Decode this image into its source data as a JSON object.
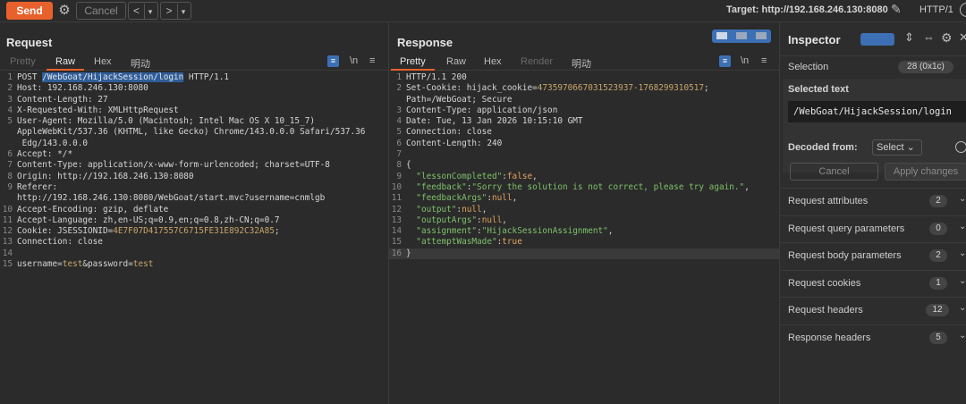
{
  "toolbar": {
    "send_label": "Send",
    "cancel_label": "Cancel",
    "prev_glyph": "<",
    "next_glyph": ">",
    "dropdown_glyph": "▾",
    "target_label": "Target: http://192.168.246.130:8080",
    "http_version": "HTTP/1"
  },
  "request": {
    "title": "Request",
    "tabs": [
      {
        "label": "Pretty"
      },
      {
        "label": "Raw"
      },
      {
        "label": "Hex"
      },
      {
        "label": "明动"
      }
    ],
    "newline_toggle": "\\n",
    "lines": [
      {
        "n": "1",
        "parts": [
          [
            "k",
            "POST "
          ],
          [
            "sel",
            "/WebGoat/HijackSession/login"
          ],
          [
            "k",
            " HTTP/1.1"
          ]
        ]
      },
      {
        "n": "2",
        "parts": [
          [
            "k",
            "Host: "
          ],
          [
            "k",
            "192.168.246.130:8080"
          ]
        ]
      },
      {
        "n": "3",
        "parts": [
          [
            "k",
            "Content-Length: 27"
          ]
        ]
      },
      {
        "n": "4",
        "parts": [
          [
            "k",
            "X-Requested-With: "
          ],
          [
            "k",
            "XMLHttpRequest"
          ]
        ]
      },
      {
        "n": "5",
        "parts": [
          [
            "k",
            "User-Agent: "
          ],
          [
            "k",
            "Mozilla/5.0 (Macintosh; Intel Mac OS X 10_15_7)"
          ]
        ]
      },
      {
        "n": "",
        "parts": [
          [
            "k",
            "AppleWebKit/537.36 (KHTML, like Gecko) Chrome/143.0.0.0 Safari/537.36"
          ]
        ]
      },
      {
        "n": "",
        "parts": [
          [
            "k",
            " Edg/143.0.0.0"
          ]
        ]
      },
      {
        "n": "6",
        "parts": [
          [
            "k",
            "Accept: "
          ],
          [
            "k",
            "*/*"
          ]
        ]
      },
      {
        "n": "7",
        "parts": [
          [
            "k",
            "Content-Type: "
          ],
          [
            "k",
            "application/x-www-form-urlencoded; charset=UTF-8"
          ]
        ]
      },
      {
        "n": "8",
        "parts": [
          [
            "k",
            "Origin: "
          ],
          [
            "k",
            "http://192.168.246.130:8080"
          ]
        ]
      },
      {
        "n": "9",
        "parts": [
          [
            "k",
            "Referer:"
          ]
        ]
      },
      {
        "n": "",
        "parts": [
          [
            "k",
            "http://192.168.246.130:8080/WebGoat/start.mvc?username=cnmlgb"
          ]
        ]
      },
      {
        "n": "10",
        "parts": [
          [
            "k",
            "Accept-Encoding: "
          ],
          [
            "k",
            "gzip, deflate"
          ]
        ]
      },
      {
        "n": "11",
        "parts": [
          [
            "k",
            "Accept-Language: "
          ],
          [
            "k",
            "zh,en-US;q=0.9,en;q=0.8,zh-CN;q=0.7"
          ]
        ]
      },
      {
        "n": "12",
        "parts": [
          [
            "k",
            "Cookie: JSESSIONID="
          ],
          [
            "v",
            "4E7F07D417557C6715FE31E892C32A85"
          ],
          [
            "k",
            ";"
          ]
        ]
      },
      {
        "n": "13",
        "parts": [
          [
            "k",
            "Connection: "
          ],
          [
            "k",
            "close"
          ]
        ]
      },
      {
        "n": "14",
        "parts": []
      },
      {
        "n": "15",
        "parts": [
          [
            "k",
            "username="
          ],
          [
            "v",
            "test"
          ],
          [
            "k",
            "&password="
          ],
          [
            "v",
            "test"
          ]
        ]
      }
    ]
  },
  "response": {
    "title": "Response",
    "tabs": [
      {
        "label": "Pretty"
      },
      {
        "label": "Raw"
      },
      {
        "label": "Hex"
      },
      {
        "label": "Render"
      },
      {
        "label": "明动"
      }
    ],
    "newline_toggle": "\\n",
    "lines": [
      {
        "n": "1",
        "parts": [
          [
            "k",
            "HTTP/1.1 200"
          ]
        ]
      },
      {
        "n": "2",
        "parts": [
          [
            "k",
            "Set-Cookie: "
          ],
          [
            "k",
            "hijack_cookie="
          ],
          [
            "v",
            "4735970667031523937-1768299310517"
          ],
          [
            "k",
            ";"
          ]
        ]
      },
      {
        "n": "",
        "parts": [
          [
            "k",
            "Path=/WebGoat; Secure"
          ]
        ]
      },
      {
        "n": "3",
        "parts": [
          [
            "k",
            "Content-Type: "
          ],
          [
            "k",
            "application/json"
          ]
        ]
      },
      {
        "n": "4",
        "parts": [
          [
            "k",
            "Date: "
          ],
          [
            "k",
            "Tue, 13 Jan 2026 10:15:10 GMT"
          ]
        ]
      },
      {
        "n": "5",
        "parts": [
          [
            "k",
            "Connection: "
          ],
          [
            "k",
            "close"
          ]
        ]
      },
      {
        "n": "6",
        "parts": [
          [
            "k",
            "Content-Length: "
          ],
          [
            "k",
            "240"
          ]
        ]
      },
      {
        "n": "7",
        "parts": []
      },
      {
        "n": "8",
        "parts": [
          [
            "k",
            "{"
          ]
        ]
      },
      {
        "n": "9",
        "parts": [
          [
            "k",
            "  "
          ],
          [
            "g",
            "\"lessonCompleted\""
          ],
          [
            "k",
            ":"
          ],
          [
            "o",
            "false"
          ],
          [
            "k",
            ","
          ]
        ]
      },
      {
        "n": "10",
        "parts": [
          [
            "k",
            "  "
          ],
          [
            "g",
            "\"feedback\""
          ],
          [
            "k",
            ":"
          ],
          [
            "g",
            "\"Sorry the solution is not correct, please try again.\""
          ],
          [
            "k",
            ","
          ]
        ]
      },
      {
        "n": "11",
        "parts": [
          [
            "k",
            "  "
          ],
          [
            "g",
            "\"feedbackArgs\""
          ],
          [
            "k",
            ":"
          ],
          [
            "o",
            "null"
          ],
          [
            "k",
            ","
          ]
        ]
      },
      {
        "n": "12",
        "parts": [
          [
            "k",
            "  "
          ],
          [
            "g",
            "\"output\""
          ],
          [
            "k",
            ":"
          ],
          [
            "o",
            "null"
          ],
          [
            "k",
            ","
          ]
        ]
      },
      {
        "n": "13",
        "parts": [
          [
            "k",
            "  "
          ],
          [
            "g",
            "\"outputArgs\""
          ],
          [
            "k",
            ":"
          ],
          [
            "o",
            "null"
          ],
          [
            "k",
            ","
          ]
        ]
      },
      {
        "n": "14",
        "parts": [
          [
            "k",
            "  "
          ],
          [
            "g",
            "\"assignment\""
          ],
          [
            "k",
            ":"
          ],
          [
            "g",
            "\"HijackSessionAssignment\""
          ],
          [
            "k",
            ","
          ]
        ]
      },
      {
        "n": "15",
        "parts": [
          [
            "k",
            "  "
          ],
          [
            "g",
            "\"attemptWasMade\""
          ],
          [
            "k",
            ":"
          ],
          [
            "o",
            "true"
          ]
        ]
      },
      {
        "n": "16",
        "parts": [
          [
            "k",
            "}"
          ]
        ]
      }
    ]
  },
  "inspector": {
    "title": "Inspector",
    "selection_label": "Selection",
    "selection_value": "28 (0x1c)",
    "selected_text_label": "Selected text",
    "selected_text_value": "/WebGoat/HijackSession/login",
    "decoded_from_label": "Decoded from:",
    "decoded_from_value": "Select",
    "cancel_label": "Cancel",
    "apply_label": "Apply changes",
    "sections": [
      {
        "label": "Request attributes",
        "count": "2"
      },
      {
        "label": "Request query parameters",
        "count": "0"
      },
      {
        "label": "Request body parameters",
        "count": "2"
      },
      {
        "label": "Request cookies",
        "count": "1"
      },
      {
        "label": "Request headers",
        "count": "12"
      },
      {
        "label": "Response headers",
        "count": "5"
      }
    ]
  },
  "colors": {
    "accent": "#e8612c",
    "selection": "#2f5d9a",
    "toggle_blue": "#3d6fb4"
  }
}
